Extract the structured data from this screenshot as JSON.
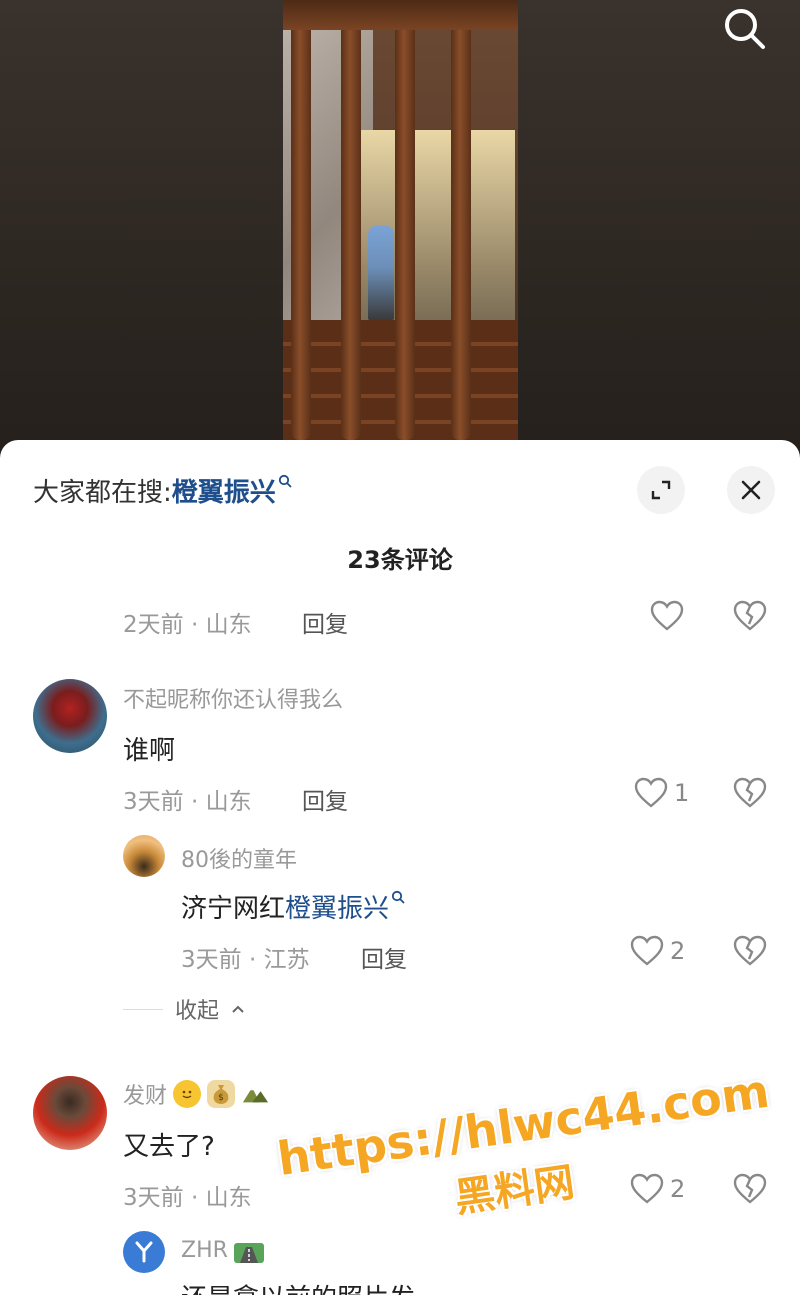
{
  "hot_search": {
    "prefix": "大家都在搜:",
    "keyword": "橙翼振兴"
  },
  "comment_count": "23条评论",
  "partial_comment": {
    "meta": "2天前 · 山东",
    "reply": "回复"
  },
  "comments": [
    {
      "username": "不起昵称你还认得我么",
      "content": "谁啊",
      "meta": "3天前 · 山东",
      "reply": "回复",
      "likes": "1",
      "replies": [
        {
          "username": "80後的童年",
          "content_prefix": "济宁网红",
          "content_link": "橙翼振兴",
          "meta": "3天前 · 江苏",
          "reply": "回复",
          "likes": "2"
        }
      ],
      "collapse_label": "收起"
    },
    {
      "username": "发财",
      "content": "又去了?",
      "meta": "3天前 · 山东",
      "likes": "2",
      "replies": [
        {
          "username": "ZHR",
          "content": "还是拿以前的照片发"
        }
      ]
    }
  ],
  "watermark": {
    "url": "https://hlwc44.com",
    "name": "黑料网"
  },
  "icons": {
    "search": "search-icon",
    "expand": "expand-icon",
    "close": "close-icon",
    "like": "heart-icon",
    "dislike": "broken-heart-icon",
    "collapse": "chevron-up-icon"
  },
  "colors": {
    "link": "#1e4e8c",
    "watermark": "#f5a623"
  }
}
